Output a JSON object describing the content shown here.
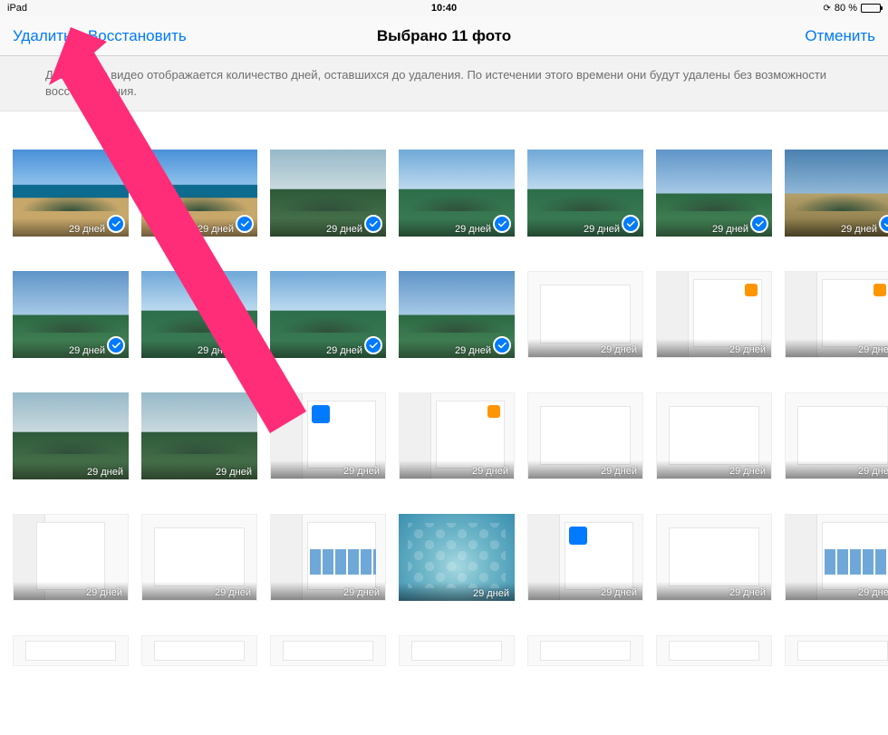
{
  "status": {
    "device": "iPad",
    "time": "10:40",
    "battery_pct": "80 %",
    "lock_glyph": "⟳"
  },
  "nav": {
    "delete": "Удалить",
    "restore": "Восстановить",
    "title": "Выбрано 11 фото",
    "cancel": "Отменить"
  },
  "banner": {
    "text": "Для фото и видео отображается количество дней, оставшихся до удаления. По истечении этого времени они будут удалены без возможности восстановления."
  },
  "days_label": "29 дней",
  "photos": [
    {
      "type": "landscape",
      "variant": "b",
      "selected": true
    },
    {
      "type": "landscape",
      "variant": "b",
      "selected": true
    },
    {
      "type": "landscape",
      "variant": "d",
      "selected": true
    },
    {
      "type": "landscape",
      "variant": "c",
      "selected": true
    },
    {
      "type": "landscape",
      "variant": "c",
      "selected": true
    },
    {
      "type": "landscape",
      "variant": "e",
      "selected": true
    },
    {
      "type": "landscape",
      "variant": "f",
      "selected": true
    },
    {
      "type": "landscape",
      "variant": "e",
      "selected": true
    },
    {
      "type": "landscape",
      "variant": "c",
      "selected": true
    },
    {
      "type": "landscape",
      "variant": "c",
      "selected": true
    },
    {
      "type": "landscape",
      "variant": "e",
      "selected": true
    },
    {
      "type": "screenshot",
      "variant": "plain",
      "selected": false
    },
    {
      "type": "screenshot",
      "variant": "orange",
      "selected": false
    },
    {
      "type": "screenshot",
      "variant": "orange",
      "selected": false
    },
    {
      "type": "landscape",
      "variant": "d",
      "selected": false
    },
    {
      "type": "landscape",
      "variant": "d",
      "selected": false
    },
    {
      "type": "screenshot",
      "variant": "blueblock",
      "selected": false
    },
    {
      "type": "screenshot",
      "variant": "orange",
      "selected": false
    },
    {
      "type": "screenshot",
      "variant": "plain",
      "selected": false
    },
    {
      "type": "screenshot",
      "variant": "plain",
      "selected": false
    },
    {
      "type": "screenshot",
      "variant": "plain",
      "selected": false
    },
    {
      "type": "screenshot",
      "variant": "center",
      "selected": false
    },
    {
      "type": "screenshot",
      "variant": "plain",
      "selected": false
    },
    {
      "type": "screenshot",
      "variant": "thumbs",
      "selected": false
    },
    {
      "type": "homescreen",
      "variant": "",
      "selected": false
    },
    {
      "type": "screenshot",
      "variant": "blueblock",
      "selected": false
    },
    {
      "type": "screenshot",
      "variant": "plain",
      "selected": false
    },
    {
      "type": "screenshot",
      "variant": "thumbs",
      "selected": false
    }
  ],
  "last_row_count": 7
}
